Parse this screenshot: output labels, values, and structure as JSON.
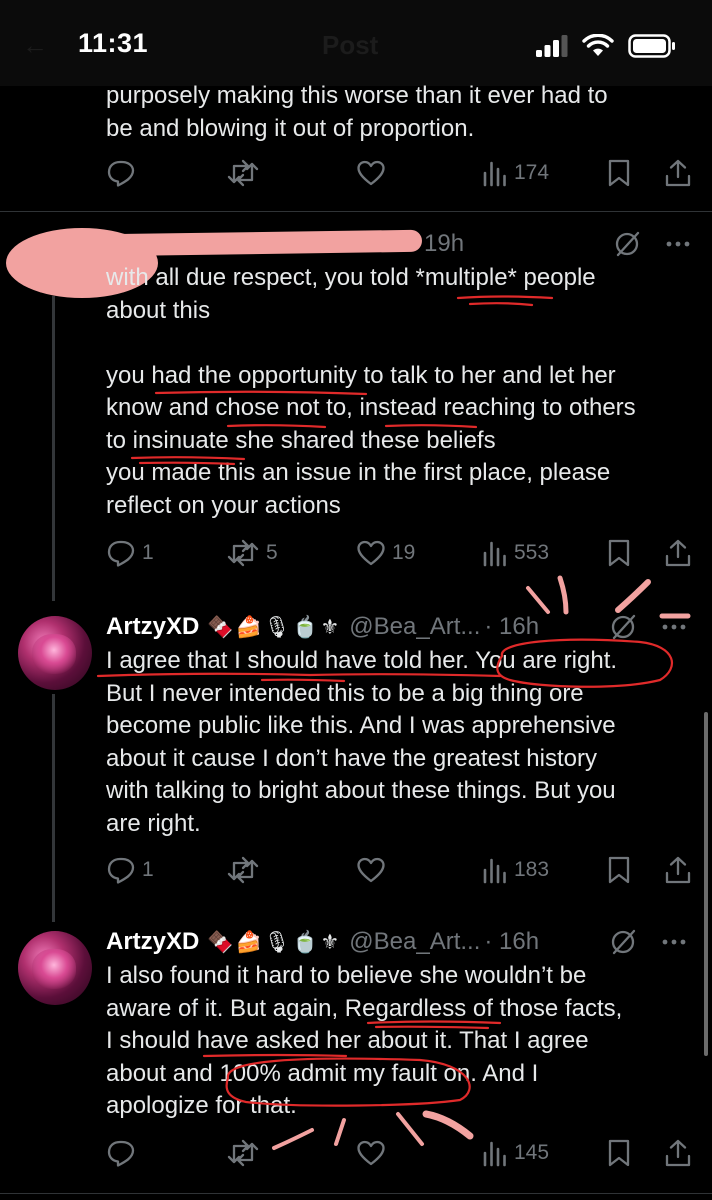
{
  "status_bar": {
    "time": "11:31",
    "screen_title": "Post"
  },
  "colors": {
    "background": "#000000",
    "text": "#e7e9ea",
    "muted": "#71767b",
    "redaction": "#f2a2a0",
    "annotation_red": "#e02a2a"
  },
  "tweets": [
    {
      "text": "purposely making this worse than it ever had to\nbe and blowing it out of proportion.",
      "replies": "",
      "reposts": "",
      "likes": "",
      "views": "174"
    },
    {
      "time": "19h",
      "text": "with all due respect, you told *multiple* people\nabout this\n\nyou had the opportunity to talk to her and let her\nknow and chose not to, instead reaching to others\nto insinuate she shared these beliefs\nyou made this an issue in the first place, please\nreflect on your actions",
      "replies": "1",
      "reposts": "5",
      "likes": "19",
      "views": "553"
    },
    {
      "name": "ArtzyXD",
      "emojis": "🍫🍰🎙🍵⚜",
      "handle": "@Bea_Art...",
      "time": "· 16h",
      "text": "I agree that I should have told her. You are right.\nBut I never intended this to be a big thing ore\nbecome public like this. And I was apprehensive\nabout it cause I don’t have the greatest history\nwith talking to bright about these things. But you\nare right.",
      "replies": "1",
      "reposts": "",
      "likes": "",
      "views": "183"
    },
    {
      "name": "ArtzyXD",
      "emojis": "🍫🍰🎙🍵⚜",
      "handle": "@Bea_Art...",
      "time": "· 16h",
      "text": "I also found it hard to believe she wouldn’t be\naware of it. But again, Regardless of those facts,\nI should have asked her about it. That I agree\nabout and 100% admit my fault on. And I\napologize for that.",
      "replies": "",
      "reposts": "",
      "likes": "",
      "views": "145"
    }
  ]
}
